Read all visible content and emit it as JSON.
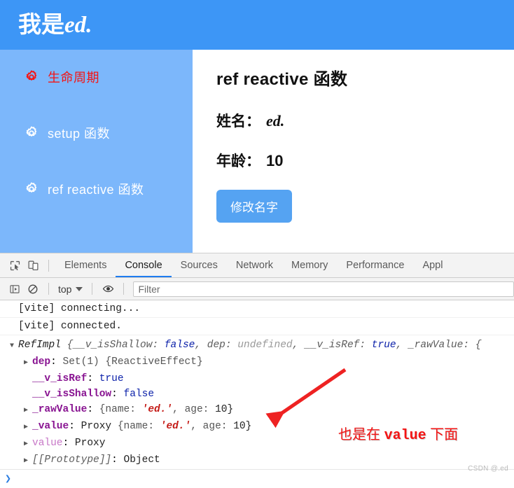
{
  "colors": {
    "header_blue": "#3d96f6",
    "sidebar_blue": "#7cb7fb",
    "button_blue": "#55a3f2",
    "accent_red": "#f41414",
    "devtools_tab_active": "#1e7cf0"
  },
  "site": {
    "header": {
      "prefix": "我是",
      "name": "ed."
    },
    "sidebar": {
      "items": [
        {
          "label": "生命周期",
          "icon": "gear-icon",
          "active": true
        },
        {
          "label": "setup 函数",
          "icon": "gear-icon",
          "active": false
        },
        {
          "label": "ref reactive 函数",
          "icon": "gear-icon",
          "active": false
        }
      ]
    },
    "content": {
      "heading": "ref reactive 函数",
      "name_label": "姓名：",
      "name_value": "ed.",
      "age_label": "年龄：",
      "age_value": "10",
      "button_label": "修改名字"
    }
  },
  "devtools": {
    "toolbar_icons": [
      "inspect-element-icon",
      "device-toolbar-icon"
    ],
    "tabs": [
      {
        "label": "Elements",
        "active": false
      },
      {
        "label": "Console",
        "active": true
      },
      {
        "label": "Sources",
        "active": false
      },
      {
        "label": "Network",
        "active": false
      },
      {
        "label": "Memory",
        "active": false
      },
      {
        "label": "Performance",
        "active": false
      },
      {
        "label": "Appl",
        "active": false
      }
    ],
    "filterbar": {
      "sidebar_toggle_icon": "console-sidebar-icon",
      "clear_icon": "clear-console-icon",
      "context": "top",
      "eye_icon": "live-expression-icon",
      "filter_placeholder": "Filter",
      "filter_value": ""
    },
    "console": {
      "messages": [
        {
          "text": "[vite] connecting..."
        },
        {
          "text": "[vite] connected."
        }
      ],
      "object": {
        "header": {
          "triangle": "▼",
          "class_name": "RefImpl",
          "open_brace": "{",
          "props": [
            {
              "key": "__v_isShallow",
              "sep": ": ",
              "value": "false",
              "value_kind": "bool"
            },
            {
              "key": "dep",
              "sep": ": ",
              "value": "undefined",
              "value_kind": "undefined"
            },
            {
              "key": "__v_isRef",
              "sep": ": ",
              "value": "true",
              "value_kind": "bool"
            },
            {
              "key": "_rawValue",
              "sep": ": ",
              "value": "{",
              "value_kind": "truncated"
            }
          ]
        },
        "rows": [
          {
            "triangle": "▶",
            "key": "dep",
            "key_kind": "normal",
            "value": "Set(1) {ReactiveEffect}",
            "value_kind": "plain"
          },
          {
            "triangle": "",
            "key": "__v_isRef",
            "key_kind": "normal",
            "value": "true",
            "value_kind": "bool"
          },
          {
            "triangle": "",
            "key": "__v_isShallow",
            "key_kind": "normal",
            "value": "false",
            "value_kind": "bool"
          },
          {
            "triangle": "▶",
            "key": "_rawValue",
            "key_kind": "normal",
            "value": "{name: 'ed.', age: 10}",
            "value_kind": "objpreview"
          },
          {
            "triangle": "▶",
            "key": "_value",
            "key_kind": "normal",
            "value": "Proxy {name: 'ed.', age: 10}",
            "value_kind": "objpreview_proxy"
          },
          {
            "triangle": "▶",
            "key": "value",
            "key_kind": "getter",
            "value": "Proxy",
            "value_kind": "obj"
          },
          {
            "triangle": "▶",
            "key": "[[Prototype]]",
            "key_kind": "proto",
            "value": "Object",
            "value_kind": "obj"
          }
        ]
      },
      "prompt_chevron": "❯"
    }
  },
  "annotation": {
    "text_prefix": "也是在",
    "text_mono": "value",
    "text_suffix": "下面",
    "arrow": "red-arrow-pointing-left"
  },
  "watermark": "CSDN @.ed"
}
